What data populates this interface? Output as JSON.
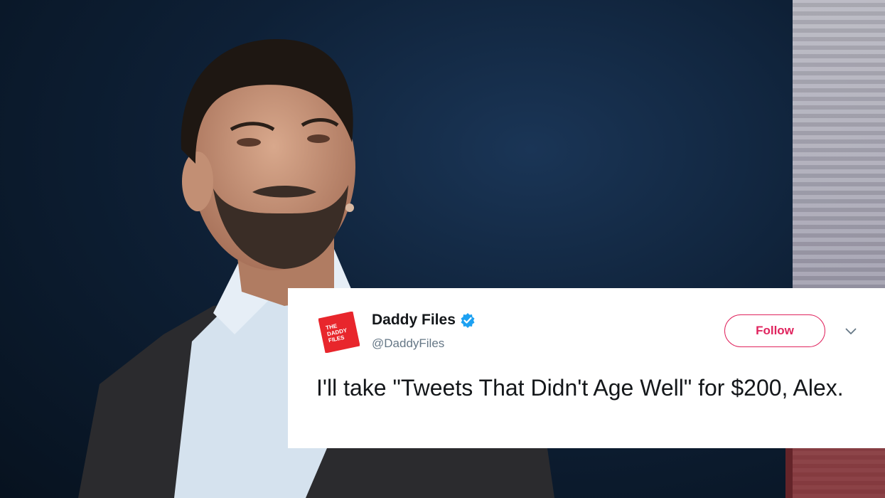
{
  "tweet": {
    "author_name": "Daddy Files",
    "handle": "@DaddyFiles",
    "follow_label": "Follow",
    "text": "I'll take \"Tweets That Didn't Age Well\" for $200, Alex.",
    "avatar_logo_text": "THE DADDY FILES",
    "icons": {
      "verified": "verified-badge-icon",
      "more": "chevron-down-icon"
    }
  },
  "colors": {
    "follow_accent": "#e0245e",
    "verified_blue": "#1da1f2",
    "avatar_red": "#e8262c"
  }
}
